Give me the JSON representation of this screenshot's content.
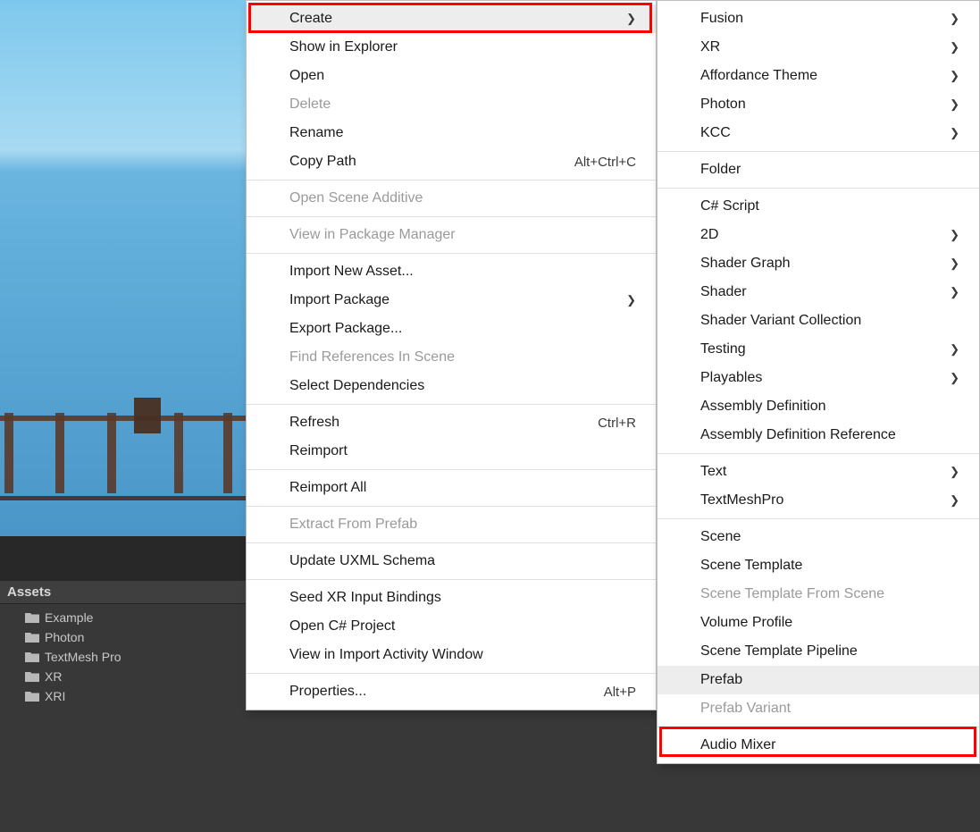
{
  "assets": {
    "header": "Assets",
    "items": [
      {
        "label": "Example"
      },
      {
        "label": "Photon"
      },
      {
        "label": "TextMesh Pro"
      },
      {
        "label": "XR"
      },
      {
        "label": "XRI"
      }
    ]
  },
  "context_menu": {
    "items": [
      {
        "label": "Create",
        "submenu": true,
        "highlight": true,
        "hover": true
      },
      {
        "label": "Show in Explorer"
      },
      {
        "label": "Open"
      },
      {
        "label": "Delete",
        "disabled": true
      },
      {
        "label": "Rename"
      },
      {
        "label": "Copy Path",
        "shortcut": "Alt+Ctrl+C"
      },
      {
        "sep": true
      },
      {
        "label": "Open Scene Additive",
        "disabled": true
      },
      {
        "sep": true
      },
      {
        "label": "View in Package Manager",
        "disabled": true
      },
      {
        "sep": true
      },
      {
        "label": "Import New Asset..."
      },
      {
        "label": "Import Package",
        "submenu": true
      },
      {
        "label": "Export Package..."
      },
      {
        "label": "Find References In Scene",
        "disabled": true
      },
      {
        "label": "Select Dependencies"
      },
      {
        "sep": true
      },
      {
        "label": "Refresh",
        "shortcut": "Ctrl+R"
      },
      {
        "label": "Reimport"
      },
      {
        "sep": true
      },
      {
        "label": "Reimport All"
      },
      {
        "sep": true
      },
      {
        "label": "Extract From Prefab",
        "disabled": true
      },
      {
        "sep": true
      },
      {
        "label": "Update UXML Schema"
      },
      {
        "sep": true
      },
      {
        "label": "Seed XR Input Bindings"
      },
      {
        "label": "Open C# Project"
      },
      {
        "label": "View in Import Activity Window"
      },
      {
        "sep": true
      },
      {
        "label": "Properties...",
        "shortcut": "Alt+P"
      }
    ]
  },
  "create_submenu": {
    "items": [
      {
        "label": "Fusion",
        "submenu": true
      },
      {
        "label": "XR",
        "submenu": true
      },
      {
        "label": "Affordance Theme",
        "submenu": true
      },
      {
        "label": "Photon",
        "submenu": true
      },
      {
        "label": "KCC",
        "submenu": true
      },
      {
        "sep": true
      },
      {
        "label": "Folder"
      },
      {
        "sep": true
      },
      {
        "label": "C# Script"
      },
      {
        "label": "2D",
        "submenu": true
      },
      {
        "label": "Shader Graph",
        "submenu": true
      },
      {
        "label": "Shader",
        "submenu": true
      },
      {
        "label": "Shader Variant Collection"
      },
      {
        "label": "Testing",
        "submenu": true
      },
      {
        "label": "Playables",
        "submenu": true
      },
      {
        "label": "Assembly Definition"
      },
      {
        "label": "Assembly Definition Reference"
      },
      {
        "sep": true
      },
      {
        "label": "Text",
        "submenu": true
      },
      {
        "label": "TextMeshPro",
        "submenu": true
      },
      {
        "sep": true
      },
      {
        "label": "Scene"
      },
      {
        "label": "Scene Template"
      },
      {
        "label": "Scene Template From Scene",
        "disabled": true
      },
      {
        "label": "Volume Profile"
      },
      {
        "label": "Scene Template Pipeline"
      },
      {
        "label": "Prefab",
        "highlight": true,
        "hover": true
      },
      {
        "label": "Prefab Variant",
        "disabled": true
      },
      {
        "sep": true
      },
      {
        "label": "Audio Mixer"
      }
    ]
  }
}
